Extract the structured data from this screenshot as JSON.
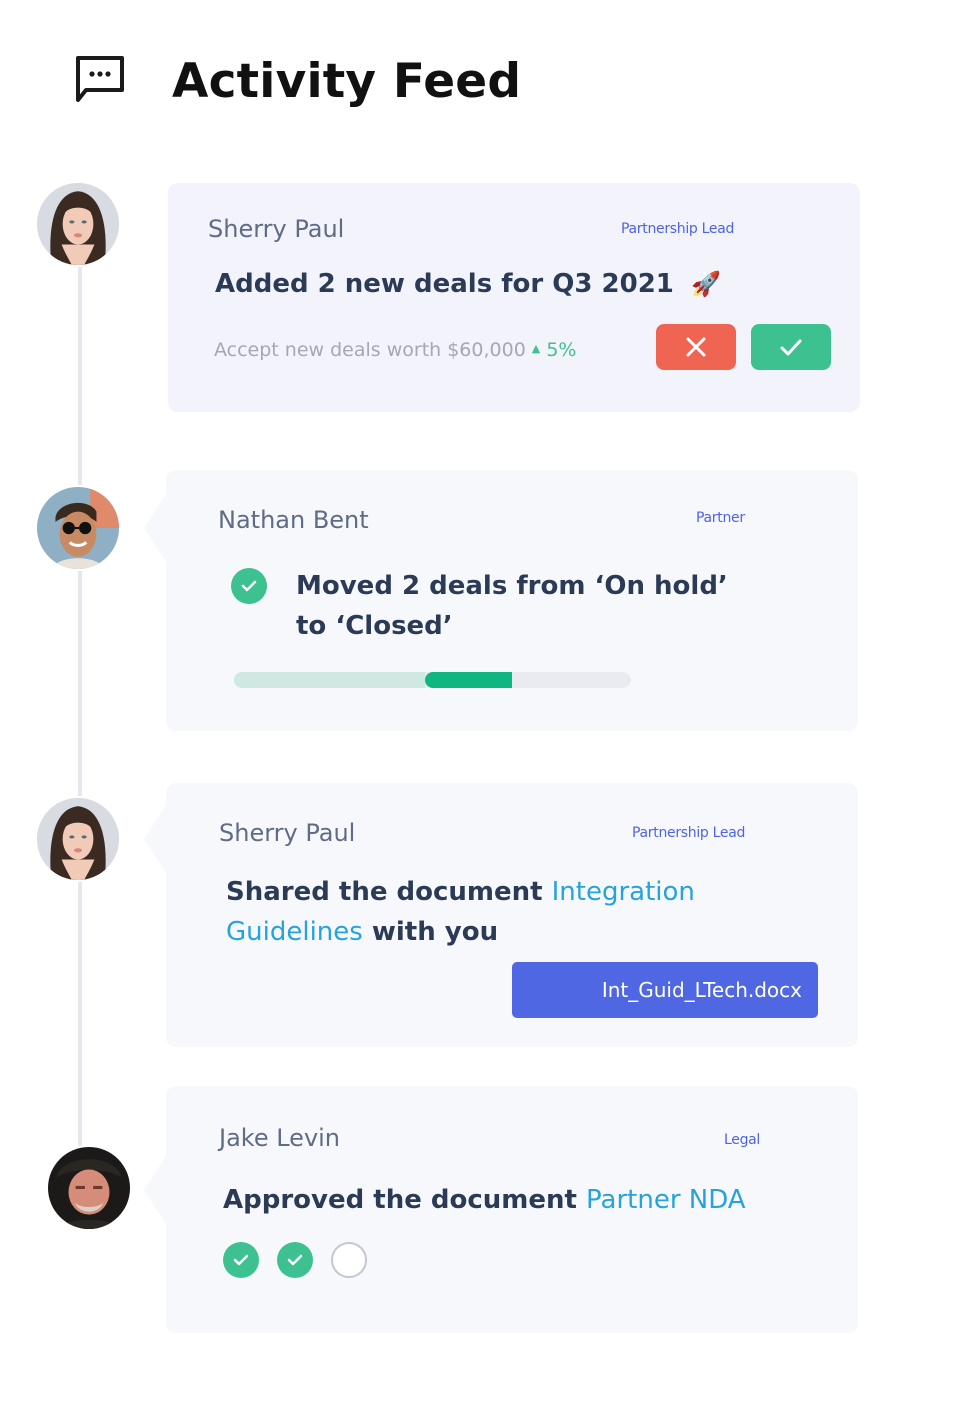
{
  "header": {
    "icon": "chat-bubble-dots-icon",
    "title": "Activity Feed"
  },
  "colors": {
    "accent_blue": "#4f67e3",
    "link_blue": "#27a3dc",
    "success_green": "#3ec190",
    "danger_red": "#f06452",
    "role_blue": "#4e63e6"
  },
  "feed": [
    {
      "user": "Sherry Paul",
      "role": "Partnership Lead",
      "avatar": "avatar-woman-dark-hair",
      "title": "Added 2 new deals for Q3 2021",
      "title_emoji": "🚀",
      "subtext": "Accept new deals worth $60,000",
      "delta_arrow": "▲",
      "delta": "5%",
      "reject_icon": "close-icon",
      "accept_icon": "check-icon"
    },
    {
      "user": "Nathan Bent",
      "role": "Partner",
      "avatar": "avatar-man-sunglasses",
      "status_icon": "check-circle-icon",
      "title": "Moved 2 deals from ‘On hold’ to ‘Closed’",
      "progress": {
        "completed_fraction": 0.48,
        "active_fraction": 0.22,
        "remaining_fraction": 0.3
      }
    },
    {
      "user": "Sherry Paul",
      "role": "Partnership Lead",
      "avatar": "avatar-woman-dark-hair",
      "title_prefix": "Shared the document ",
      "title_link": "Integration Guidelines",
      "title_suffix": " with you",
      "file_name": "Int_Guid_LTech.docx"
    },
    {
      "user": "Jake Levin",
      "role": "Legal",
      "avatar": "avatar-older-man",
      "title_prefix": "Approved the document ",
      "title_link": "Partner NDA",
      "approvals": [
        {
          "state": "approved"
        },
        {
          "state": "approved"
        },
        {
          "state": "pending"
        }
      ]
    }
  ]
}
